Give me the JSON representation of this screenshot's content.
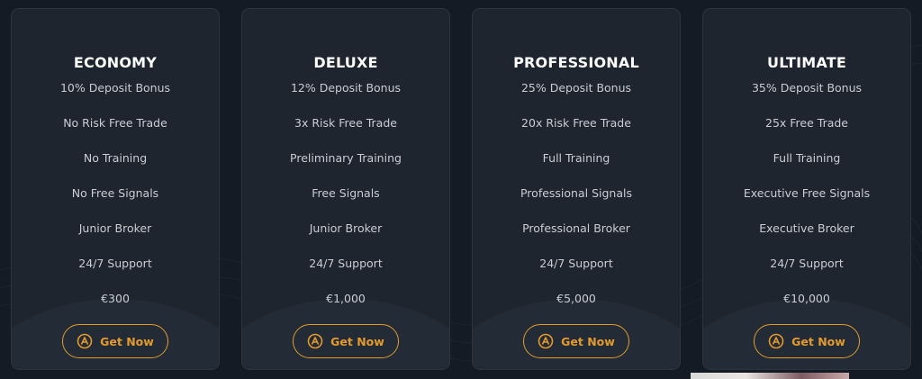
{
  "plans": [
    {
      "title": "ECONOMY",
      "features": [
        "10% Deposit Bonus",
        "No Risk Free Trade",
        "No Training",
        "No Free Signals",
        "Junior Broker",
        "24/7 Support"
      ],
      "price": "€300",
      "button_label": "Get Now"
    },
    {
      "title": "DELUXE",
      "features": [
        "12% Deposit Bonus",
        "3x Risk Free Trade",
        "Preliminary Training",
        "Free Signals",
        "Junior Broker",
        "24/7 Support"
      ],
      "price": "€1,000",
      "button_label": "Get Now"
    },
    {
      "title": "PROFESSIONAL",
      "features": [
        "25% Deposit Bonus",
        "20x Risk Free Trade",
        "Full Training",
        "Professional Signals",
        "Professional Broker",
        "24/7 Support"
      ],
      "price": "€5,000",
      "button_label": "Get Now"
    },
    {
      "title": "ULTIMATE",
      "features": [
        "35% Deposit Bonus",
        "25x Free Trade",
        "Full Training",
        "Executive Free Signals",
        "Executive Broker",
        "24/7 Support"
      ],
      "price": "€10,000",
      "button_label": "Get Now"
    }
  ],
  "icons": {
    "button_icon": "logo-a-icon"
  },
  "colors": {
    "accent": "#e39a2d",
    "background": "#151b24",
    "card": "#1e252f"
  }
}
